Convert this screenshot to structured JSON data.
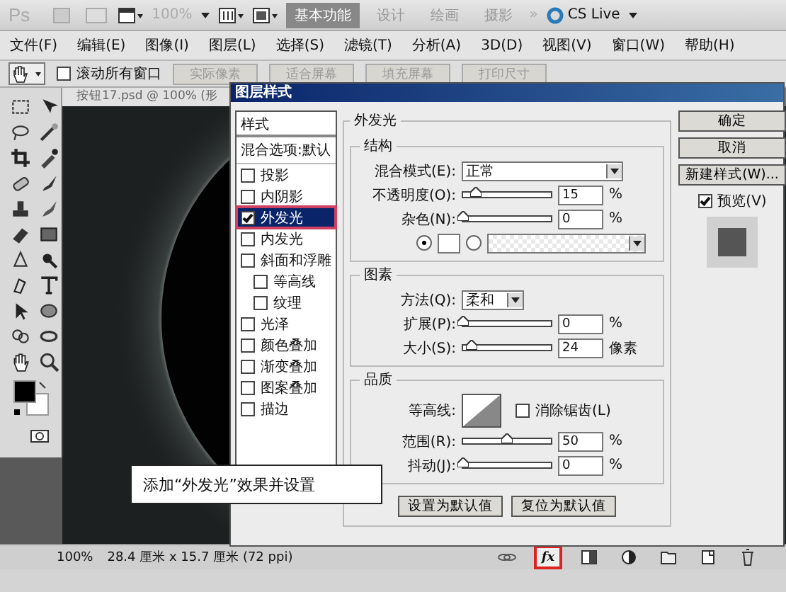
{
  "app_bar": {
    "logo": "Ps",
    "zoom": "100%",
    "workspaces": [
      {
        "label": "基本功能",
        "selected": true
      },
      {
        "label": "设计",
        "selected": false
      },
      {
        "label": "绘画",
        "selected": false
      },
      {
        "label": "摄影",
        "selected": false
      }
    ],
    "more": "»",
    "cs_live": "CS Live"
  },
  "menu": [
    "文件(F)",
    "编辑(E)",
    "图像(I)",
    "图层(L)",
    "选择(S)",
    "滤镜(T)",
    "分析(A)",
    "3D(D)",
    "视图(V)",
    "窗口(W)",
    "帮助(H)"
  ],
  "options_bar": {
    "scroll_all": {
      "label": "滚动所有窗口",
      "checked": false
    },
    "buttons": [
      {
        "label": "实际像素",
        "disabled": true
      },
      {
        "label": "适合屏幕",
        "disabled": true
      },
      {
        "label": "填充屏幕",
        "disabled": true
      },
      {
        "label": "打印尺寸",
        "disabled": true
      }
    ]
  },
  "document": {
    "tab": "按钮17.psd @ 100% (形"
  },
  "dialog": {
    "title": "图层样式",
    "styles_header": "样式",
    "blend_options": "混合选项:默认",
    "styles": [
      {
        "label": "投影",
        "checked": false,
        "selected": false
      },
      {
        "label": "内阴影",
        "checked": false,
        "selected": false
      },
      {
        "label": "外发光",
        "checked": true,
        "selected": true
      },
      {
        "label": "内发光",
        "checked": false,
        "selected": false
      },
      {
        "label": "斜面和浮雕",
        "checked": false,
        "selected": false,
        "children": [
          {
            "label": "等高线",
            "checked": false,
            "selected": false
          },
          {
            "label": "纹理",
            "checked": false,
            "selected": false
          }
        ]
      },
      {
        "label": "光泽",
        "checked": false,
        "selected": false
      },
      {
        "label": "颜色叠加",
        "checked": false,
        "selected": false
      },
      {
        "label": "渐变叠加",
        "checked": false,
        "selected": false
      },
      {
        "label": "图案叠加",
        "checked": false,
        "selected": false
      },
      {
        "label": "描边",
        "checked": false,
        "selected": false
      }
    ],
    "panel_title": "外发光",
    "structure": {
      "title": "结构",
      "blend_mode": {
        "label": "混合模式(E):",
        "value": "正常"
      },
      "opacity": {
        "label": "不透明度(O):",
        "level": 0.15,
        "value": "15",
        "unit": "%"
      },
      "noise": {
        "label": "杂色(N):",
        "level": 0,
        "value": "0",
        "unit": "%"
      },
      "fill": [
        {
          "kind": "color",
          "selected": true
        },
        {
          "kind": "gradient",
          "selected": false
        }
      ]
    },
    "elements": {
      "title": "图素",
      "technique": {
        "label": "方法(Q):",
        "value": "柔和"
      },
      "spread": {
        "label": "扩展(P):",
        "level": 0,
        "value": "0",
        "unit": "%"
      },
      "size": {
        "label": "大小(S):",
        "level": 0.1,
        "value": "24",
        "unit": "像素"
      }
    },
    "quality": {
      "title": "品质",
      "contour_label": "等高线:",
      "anti_alias": {
        "label": "消除锯齿(L)",
        "checked": false
      },
      "range": {
        "label": "范围(R):",
        "level": 0.5,
        "value": "50",
        "unit": "%"
      },
      "jitter": {
        "label": "抖动(J):",
        "level": 0,
        "value": "0",
        "unit": "%"
      }
    },
    "defaults_buttons": [
      "设置为默认值",
      "复位为默认值"
    ],
    "buttons": [
      "确定",
      "取消",
      "新建样式(W)..."
    ],
    "preview": {
      "label": "预览(V)",
      "checked": true
    }
  },
  "callout": "添加“外发光”效果并设置",
  "status_bar": {
    "zoom": "100%",
    "size": "28.4 厘米 x 15.7 厘米 (72 ppi)"
  },
  "layer_buttons": [
    {
      "kind": "link",
      "highlighted": false
    },
    {
      "kind": "fx",
      "label": "fx",
      "highlighted": true
    },
    {
      "kind": "mask",
      "highlighted": false
    },
    {
      "kind": "adjust",
      "highlighted": false
    },
    {
      "kind": "group",
      "highlighted": false
    },
    {
      "kind": "new",
      "highlighted": false
    },
    {
      "kind": "trash",
      "highlighted": false
    }
  ]
}
